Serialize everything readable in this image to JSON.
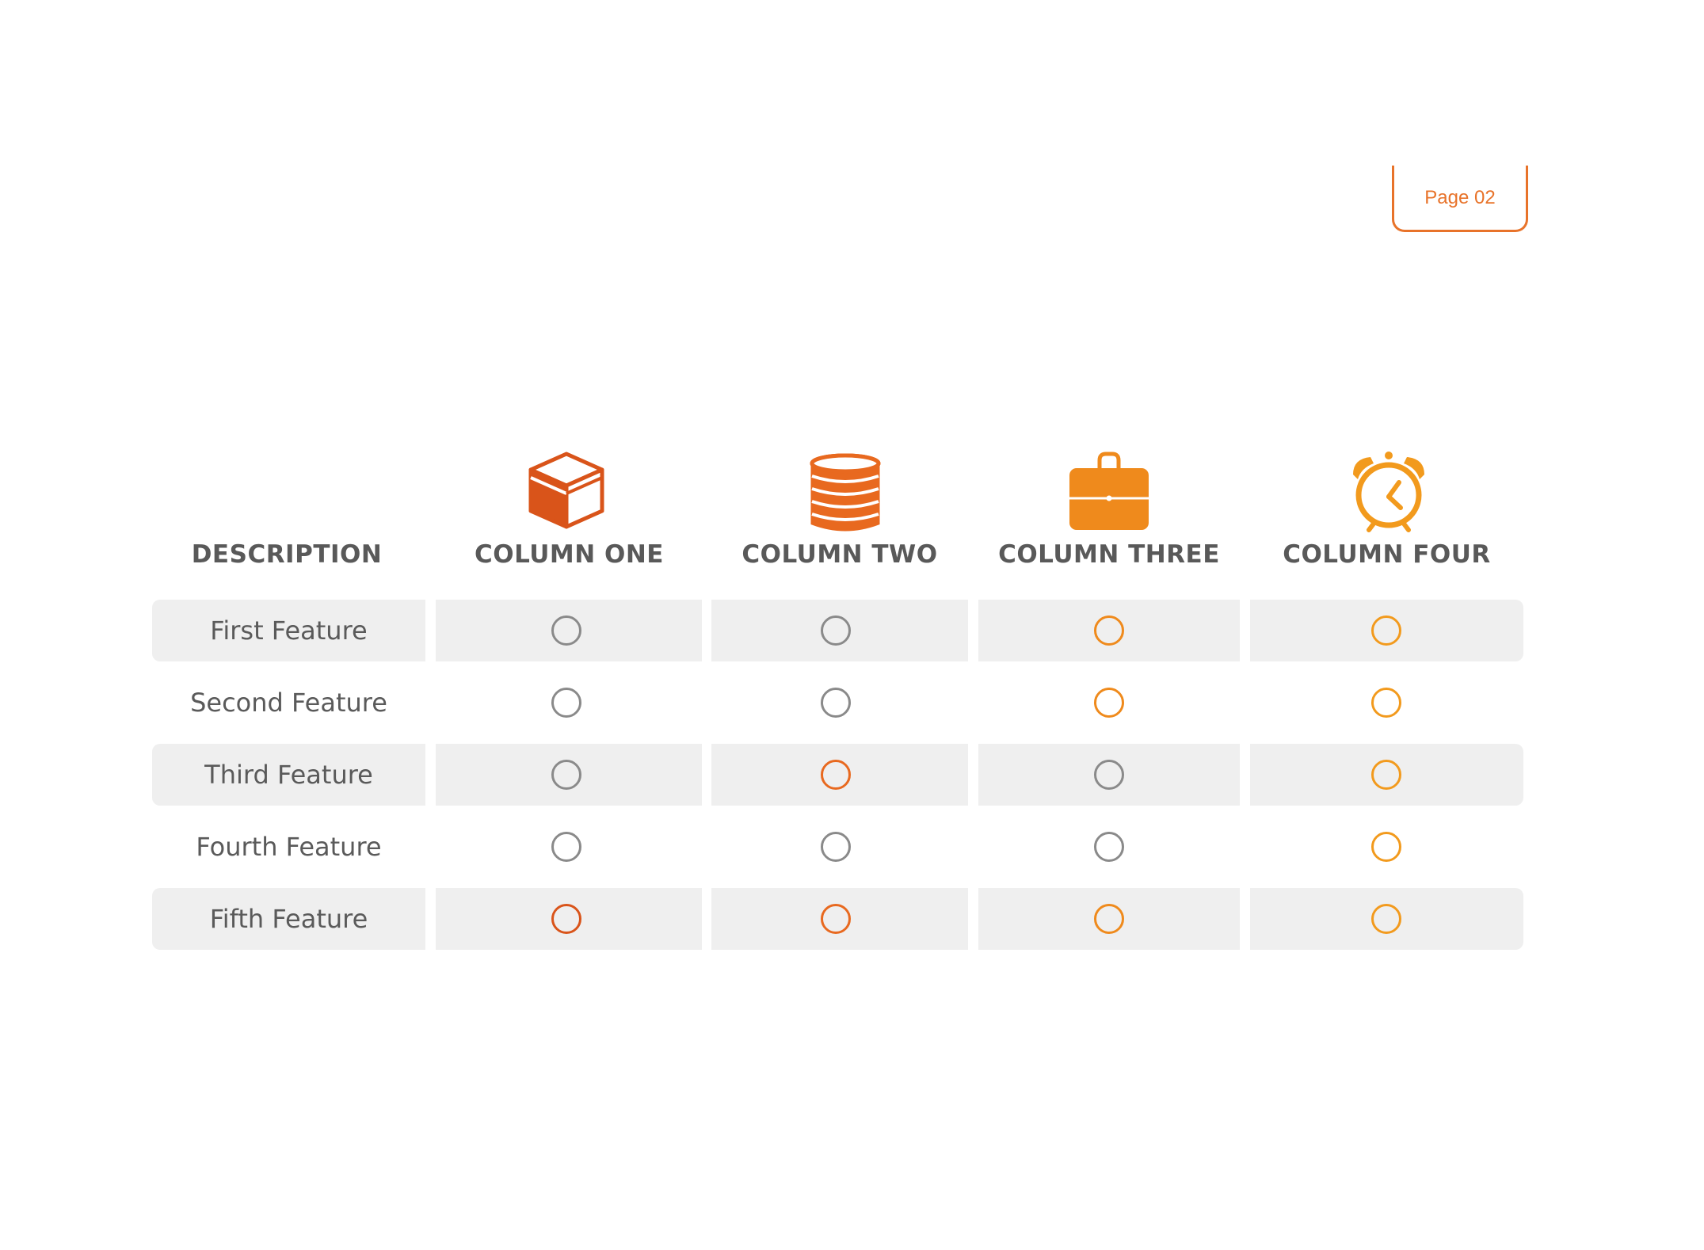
{
  "page_tab": {
    "label": "Page 02"
  },
  "header": {
    "description": "DESCRIPTION",
    "columns": [
      {
        "label": "COLUMN ONE",
        "icon": "box-icon",
        "color": "#d9541a"
      },
      {
        "label": "COLUMN TWO",
        "icon": "coins-stack-icon",
        "color": "#e8691f"
      },
      {
        "label": "COLUMN THREE",
        "icon": "briefcase-icon",
        "color": "#ef8a1c"
      },
      {
        "label": "COLUMN FOUR",
        "icon": "alarm-clock-icon",
        "color": "#f29a1d"
      }
    ]
  },
  "colors": {
    "inactive": "#8a8a8a",
    "accent": "#e8732a",
    "row_band": "#efefef",
    "text": "#595959"
  },
  "rows": [
    {
      "label": "First Feature",
      "marks": [
        "inactive",
        "inactive",
        "active",
        "active"
      ]
    },
    {
      "label": "Second Feature",
      "marks": [
        "inactive",
        "inactive",
        "active",
        "active"
      ]
    },
    {
      "label": "Third Feature",
      "marks": [
        "inactive",
        "active",
        "inactive",
        "active"
      ]
    },
    {
      "label": "Fourth Feature",
      "marks": [
        "inactive",
        "inactive",
        "inactive",
        "active"
      ]
    },
    {
      "label": "Fifth Feature",
      "marks": [
        "active",
        "active",
        "active",
        "active"
      ]
    }
  ]
}
